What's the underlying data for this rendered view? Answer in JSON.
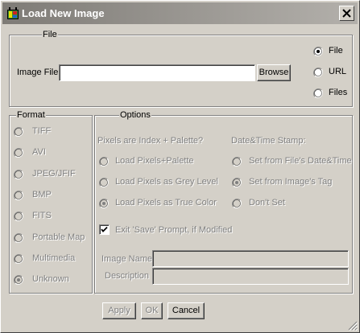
{
  "window": {
    "title": "Load New Image",
    "app_icon": "app-image-icon",
    "close_icon": "close-icon"
  },
  "file_group": {
    "legend": "File",
    "image_file_label": "Image File",
    "image_file_value": "",
    "browse_label": "Browse",
    "source_options": [
      {
        "label": "File",
        "checked": true
      },
      {
        "label": "URL",
        "checked": false
      },
      {
        "label": "Files",
        "checked": false
      }
    ]
  },
  "format_group": {
    "legend": "Format",
    "enabled": false,
    "options": [
      {
        "label": "TIFF",
        "checked": false
      },
      {
        "label": "AVI",
        "checked": false
      },
      {
        "label": "JPEG/JFIF",
        "checked": false
      },
      {
        "label": "BMP",
        "checked": false
      },
      {
        "label": "FITS",
        "checked": false
      },
      {
        "label": "Portable Map",
        "checked": false
      },
      {
        "label": "Multimedia",
        "checked": false
      },
      {
        "label": "Unknown",
        "checked": true
      }
    ]
  },
  "options_group": {
    "legend": "Options",
    "pixels_heading": "Pixels are Index + Palette?",
    "pixels_options": [
      {
        "label": "Load Pixels+Palette",
        "checked": false
      },
      {
        "label": "Load Pixels as Grey Level",
        "checked": false
      },
      {
        "label": "Load Pixels as True Color",
        "checked": true
      }
    ],
    "datetime_heading": "Date&Time Stamp:",
    "datetime_options": [
      {
        "label": "Set from File's Date&Time",
        "checked": false
      },
      {
        "label": "Set from Image's Tag",
        "checked": true
      },
      {
        "label": "Don't Set",
        "checked": false
      }
    ],
    "exit_prompt_label": "Exit 'Save' Prompt, if Modified",
    "exit_prompt_checked": true,
    "image_name_label": "Image Name",
    "image_name_value": "",
    "description_label": "Description",
    "description_value": ""
  },
  "buttons": {
    "apply": "Apply",
    "ok": "OK",
    "cancel": "Cancel"
  }
}
